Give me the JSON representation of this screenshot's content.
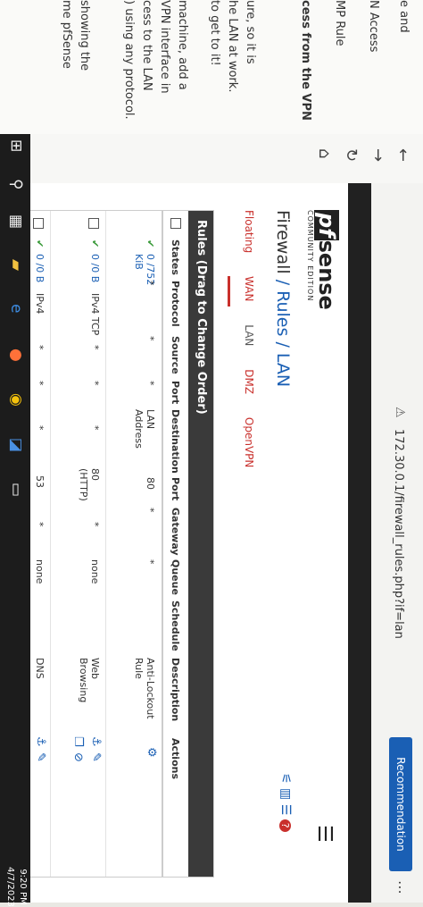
{
  "doc_strip": {
    "lines": [
      "e and",
      "N Access",
      "MP Rule",
      "cess from the VPN",
      "ure, so it is",
      "he LAN at work.",
      "to get to it!",
      "machine, add a",
      "VPN interface in",
      "cess to the LAN",
      ") using any protocol.",
      "showing the",
      "me pfSense"
    ]
  },
  "browser": {
    "url": "172.30.0.1/firewall_rules.php?if=lan",
    "recommendation_label": "Recommendation"
  },
  "pfsense": {
    "brand_name": "sense",
    "brand_prefix": "pf",
    "edition": "COMMUNITY EDITION",
    "breadcrumb": {
      "part1": "Firewall",
      "sep1": " / ",
      "part2": "Rules",
      "sep2": " / ",
      "part3": "LAN"
    },
    "tabs": [
      "Floating",
      "WAN",
      "LAN",
      "DMZ",
      "OpenVPN"
    ],
    "active_tab": "LAN",
    "panel_title": "Rules (Drag to Change Order)",
    "columns": [
      "States",
      "Protocol",
      "Source",
      "Port",
      "Destination",
      "Port",
      "Gateway",
      "Queue",
      "Schedule",
      "Description",
      "Actions"
    ],
    "rules": [
      {
        "states": "0 /752 KiB",
        "protocol": "*",
        "source": "*",
        "port": "*",
        "destination": "LAN Address",
        "dport": "80",
        "gateway": "*",
        "queue": "*",
        "schedule": "",
        "description": "Anti-Lockout Rule"
      },
      {
        "states": "0 /0 B",
        "protocol": "IPv4 TCP",
        "source": "*",
        "port": "*",
        "destination": "*",
        "dport": "80 (HTTP)",
        "gateway": "*",
        "queue": "none",
        "schedule": "",
        "description": "Web Browsing"
      },
      {
        "states": "0 /0 B",
        "protocol": "IPv4",
        "source": "*",
        "port": "*",
        "destination": "*",
        "dport": "53",
        "gateway": "*",
        "queue": "none",
        "schedule": "",
        "description": "DNS"
      }
    ]
  },
  "taskbar": {
    "time": "9:20 PM",
    "date": "4/7/2023"
  },
  "colors": {
    "accent": "#1a5fb4",
    "tab_red": "#c9302c",
    "header_dark": "#212121",
    "ok_green": "#3a9a3a"
  },
  "icons": [
    "back-icon",
    "forward-icon",
    "reload-icon",
    "home-icon",
    "settings-sliders-icon",
    "chart-icon",
    "list-icon",
    "help-icon",
    "gear-icon",
    "anchor-icon",
    "edit-icon",
    "copy-icon",
    "block-icon",
    "windows-start-icon",
    "search-icon",
    "edge-icon",
    "firefox-icon",
    "chrome-icon"
  ]
}
